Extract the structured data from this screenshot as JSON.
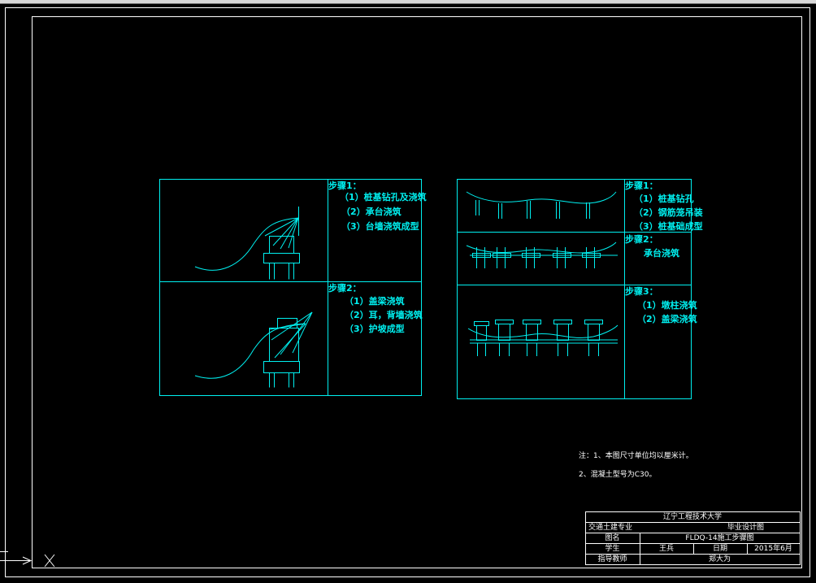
{
  "panel_left": {
    "top_step_title": "步骤1：",
    "top_items": [
      "（1）桩基钻孔及浇筑",
      "（2）承台浇筑",
      "（3）台墙浇筑成型"
    ],
    "bottom_step_title": "步骤2：",
    "bottom_items": [
      "（1）盖梁浇筑",
      "（2）耳，背墙浇筑",
      "（3）护坡成型"
    ]
  },
  "panel_right": {
    "step1_title": "步骤1：",
    "step1_items": [
      "（1）桩基钻孔",
      "（2）钢筋笼吊装",
      "（3）桩基础成型"
    ],
    "step2_title": "步骤2：",
    "step2_items": [
      "承台浇筑"
    ],
    "step3_title": "步骤3：",
    "step3_items": [
      "（1）墩柱浇筑",
      "（2）盖梁浇筑"
    ]
  },
  "notes": {
    "line1": "注：1、本图尺寸单位均以厘米计。",
    "line2": "2、混凝土型号为C30。"
  },
  "title_block": {
    "university": "辽宁工程技术大学",
    "major": "交通土建专业",
    "design_type": "毕业设计图",
    "drawing_name_label": "图名",
    "drawing_name": "FLDQ-14施工步骤图",
    "student_label": "学生",
    "student_name": "王兵",
    "date_label": "日期",
    "date": "2015年6月",
    "advisor_label": "指导教师",
    "advisor_name": "郑大为"
  },
  "colors": {
    "line": "#00f0f0",
    "frame": "#ffffff",
    "background": "#000000"
  }
}
